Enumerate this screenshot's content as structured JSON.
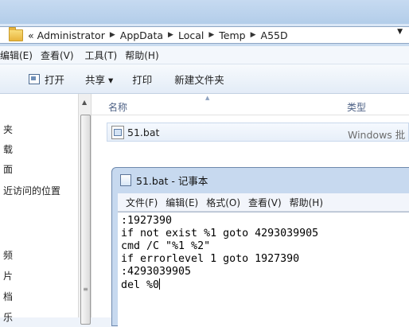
{
  "address": {
    "crumbs": [
      "« Administrator",
      "AppData",
      "Local",
      "Temp",
      "A55D"
    ]
  },
  "menubar": {
    "items": [
      "编辑(E)",
      "查看(V)",
      "工具(T)",
      "帮助(H)"
    ]
  },
  "toolbar": {
    "open_label": "打开",
    "share_label": "共享 ▾",
    "print_label": "打印",
    "new_folder_label": "新建文件夹"
  },
  "nav": {
    "items": [
      "夹",
      "载",
      "面",
      "近访问的位置",
      "频",
      "片",
      "档",
      "乐"
    ]
  },
  "filelist": {
    "columns": {
      "name": "名称",
      "type": "类型"
    },
    "rows": [
      {
        "name": "51.bat",
        "type": "Windows 批"
      }
    ]
  },
  "notepad": {
    "title": "51.bat - 记事本",
    "menu": [
      "文件(F)",
      "编辑(E)",
      "格式(O)",
      "查看(V)",
      "帮助(H)"
    ],
    "lines": [
      ":1927390",
      "if not exist %1 goto 4293039905",
      "cmd /C \"%1 %2\"",
      "if errorlevel 1 goto 1927390",
      ":4293039905",
      "del %0"
    ]
  }
}
